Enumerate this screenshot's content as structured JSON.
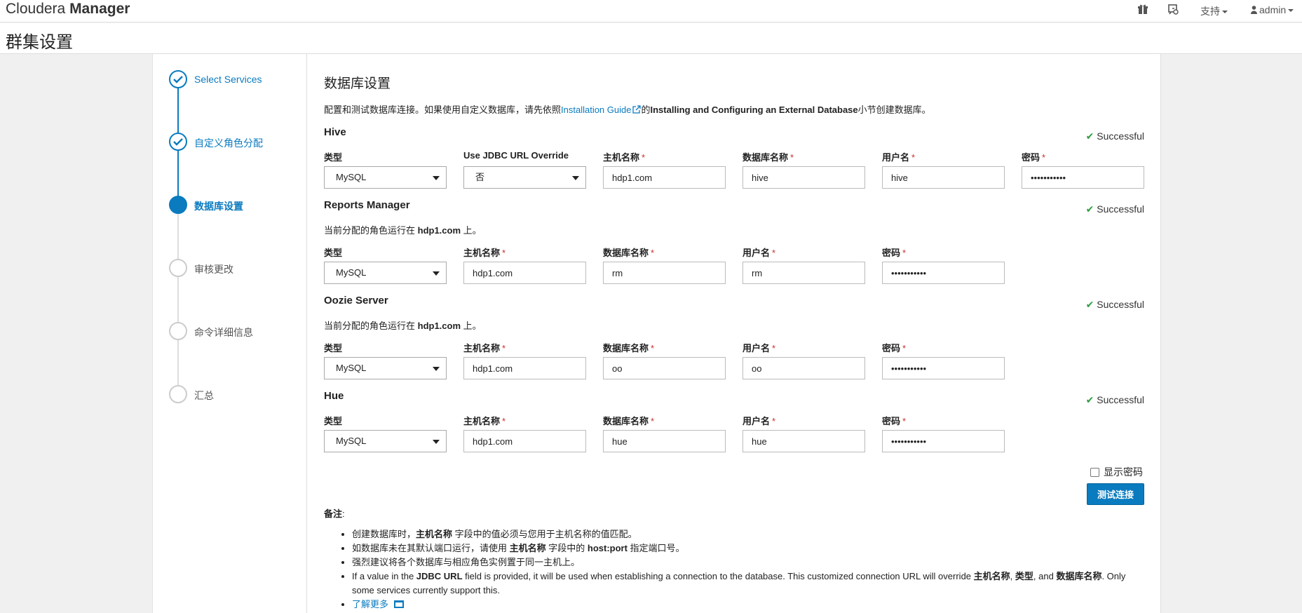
{
  "header": {
    "brand_light": "Cloudera ",
    "brand_bold": "Manager",
    "support_label": "支持",
    "user_label": "admin"
  },
  "page_title": "群集设置",
  "steps": [
    {
      "label": "Select Services",
      "state": "done"
    },
    {
      "label": "自定义角色分配",
      "state": "done"
    },
    {
      "label": "数据库设置",
      "state": "active"
    },
    {
      "label": "审核更改",
      "state": "todo"
    },
    {
      "label": "命令详细信息",
      "state": "todo"
    },
    {
      "label": "汇总",
      "state": "todo"
    }
  ],
  "main": {
    "heading": "数据库设置",
    "intro_prefix": "配置和测试数据库连接。如果使用自定义数据库，请先依照",
    "intro_link": "Installation Guide",
    "intro_mid": "的",
    "intro_bold": "Installing and Configuring an External Database",
    "intro_suffix": "小节创建数据库。",
    "status_successful": "Successful",
    "role_note_prefix": "当前分配的角色运行在 ",
    "role_note_host": "hdp1.com",
    "role_note_suffix": " 上。"
  },
  "labels": {
    "type": "类型",
    "jdbc": "Use JDBC URL Override",
    "host": "主机名称",
    "db": "数据库名称",
    "user": "用户名",
    "password": "密码",
    "required": "*"
  },
  "hive": {
    "title": "Hive",
    "type": "MySQL",
    "jdbc": "否",
    "host": "hdp1.com",
    "db": "hive",
    "user": "hive",
    "password": "•••••••••••"
  },
  "reports": {
    "title": "Reports Manager",
    "type": "MySQL",
    "host": "hdp1.com",
    "db": "rm",
    "user": "rm",
    "password": "•••••••••••"
  },
  "oozie": {
    "title": "Oozie Server",
    "type": "MySQL",
    "host": "hdp1.com",
    "db": "oo",
    "user": "oo",
    "password": "•••••••••••"
  },
  "hue": {
    "title": "Hue",
    "type": "MySQL",
    "host": "hdp1.com",
    "db": "hue",
    "user": "hue",
    "password": "•••••••••••"
  },
  "actions": {
    "show_password": "显示密码",
    "test_connection": "测试连接"
  },
  "notes": {
    "heading": "备注",
    "n1_a": "创建数据库时，",
    "n1_b": "主机名称",
    "n1_c": " 字段中的值必须与您用于主机名称的值匹配。",
    "n2_a": "如数据库未在其默认端口运行，请使用 ",
    "n2_b": "主机名称",
    "n2_c": " 字段中的 ",
    "n2_d": "host:port",
    "n2_e": " 指定端口号。",
    "n3": "强烈建议将各个数据库与相应角色实例置于同一主机上。",
    "n4_a": "If a value in the ",
    "n4_b": "JDBC URL",
    "n4_c": " field is provided, it will be used when establishing a connection to the database. This customized connection URL will override ",
    "n4_d": "主机名称",
    "n4_e": ", ",
    "n4_f": "类型",
    "n4_g": ", and ",
    "n4_h": "数据库名称",
    "n4_i": ". Only some services currently support this.",
    "learn_more": "了解更多"
  }
}
